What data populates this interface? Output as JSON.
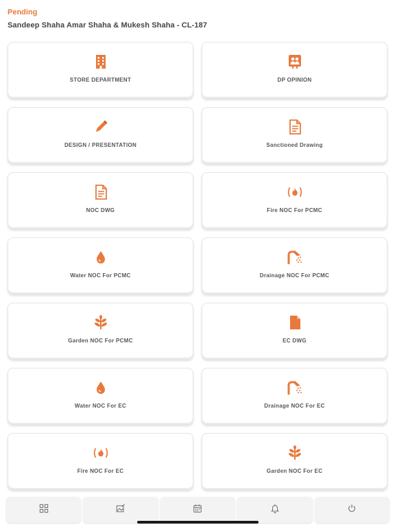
{
  "header": {
    "status": "Pending",
    "project": "Sandeep Shaha Amar Shaha & Mukesh Shaha - CL-187"
  },
  "accent_color": "#e8793c",
  "cards": [
    {
      "label": "STORE DEPARTMENT",
      "icon": "building-icon"
    },
    {
      "label": "DP OPINION",
      "icon": "people-board-icon"
    },
    {
      "label": "DESIGN / PRESENTATION",
      "icon": "pencil-icon"
    },
    {
      "label": "Sanctioned Drawing",
      "icon": "document-icon"
    },
    {
      "label": "NOC DWG",
      "icon": "document-icon"
    },
    {
      "label": "Fire NOC For PCMC",
      "icon": "fire-icon"
    },
    {
      "label": "Water NOC For PCMC",
      "icon": "water-drop-icon"
    },
    {
      "label": "Drainage NOC For PCMC",
      "icon": "shower-icon"
    },
    {
      "label": "Garden NOC For PCMC",
      "icon": "plant-icon"
    },
    {
      "label": "EC DWG",
      "icon": "file-icon"
    },
    {
      "label": "Water NOC For EC",
      "icon": "water-drop-icon"
    },
    {
      "label": "Drainage NOC For EC",
      "icon": "shower-icon"
    },
    {
      "label": "Fire NOC For EC",
      "icon": "fire-icon"
    },
    {
      "label": "Garden NOC For EC",
      "icon": "plant-icon"
    }
  ],
  "tabs": [
    {
      "icon": "grid-icon"
    },
    {
      "icon": "image-edit-icon"
    },
    {
      "icon": "calendar-icon"
    },
    {
      "icon": "bell-icon"
    },
    {
      "icon": "power-icon"
    }
  ]
}
